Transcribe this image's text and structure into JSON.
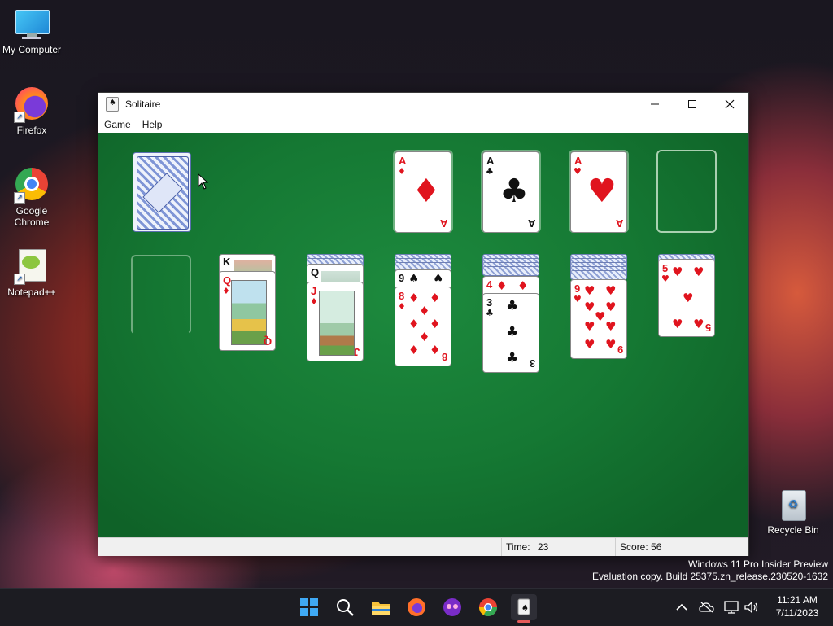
{
  "desktop": {
    "icons": [
      {
        "label": "My Computer"
      },
      {
        "label": "Firefox"
      },
      {
        "label": "Google Chrome"
      },
      {
        "label": "Notepad++"
      },
      {
        "label": "Recycle Bin"
      }
    ],
    "watermark": {
      "line1": "Windows 11 Pro Insider Preview",
      "line2": "Evaluation copy. Build 25375.zn_release.230520-1632"
    }
  },
  "window": {
    "title": "Solitaire",
    "menu": [
      "Game",
      "Help"
    ],
    "status": {
      "time_label": "Time:",
      "time_value": "23",
      "score_label": "Score:",
      "score_value": "56"
    }
  },
  "game": {
    "stock": {
      "face": "down"
    },
    "foundations": [
      {
        "rank": "A",
        "suit": "♦"
      },
      {
        "rank": "A",
        "suit": "♣"
      },
      {
        "rank": "A",
        "suit": "♥"
      },
      {
        "rank": "",
        "suit": ""
      }
    ],
    "tableau": [
      {
        "cards": []
      },
      {
        "cards": [
          {
            "rank": "K",
            "suit": "♠"
          },
          {
            "rank": "Q",
            "suit": "♦"
          }
        ]
      },
      {
        "cards": [
          {
            "rank": "Q",
            "suit": "♠"
          },
          {
            "rank": "J",
            "suit": "♦"
          }
        ]
      },
      {
        "cards": [
          {
            "rank": "9",
            "suit": "♠"
          },
          {
            "rank": "8",
            "suit": "♦"
          }
        ]
      },
      {
        "cards": [
          {
            "rank": "4",
            "suit": "♦"
          },
          {
            "rank": "3",
            "suit": "♣"
          }
        ]
      },
      {
        "cards": [
          {
            "rank": "9",
            "suit": "♥"
          }
        ]
      },
      {
        "cards": [
          {
            "rank": "5",
            "suit": "♥"
          }
        ]
      }
    ]
  },
  "taskbar": {
    "time": "11:21 AM",
    "date": "7/11/2023"
  },
  "colors": {
    "felt": "#157833",
    "red_suit": "#e0141e",
    "black_suit": "#111111"
  }
}
